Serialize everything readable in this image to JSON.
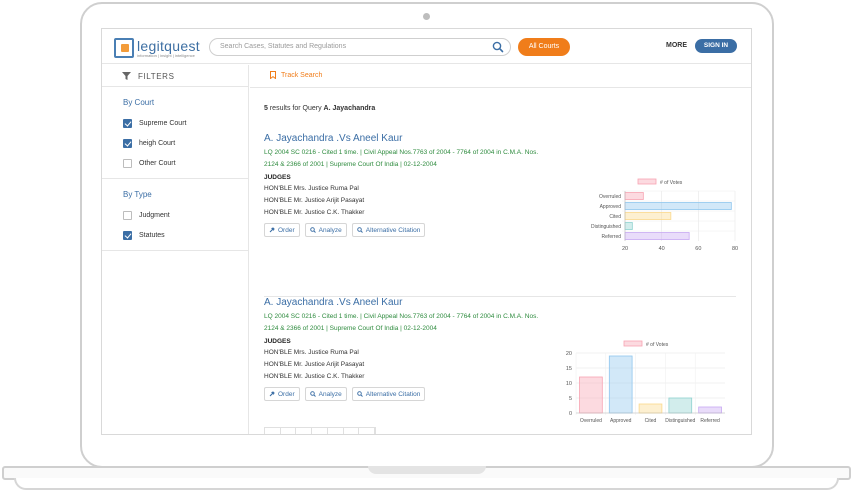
{
  "header": {
    "logo_name": "legitquest",
    "logo_tagline": "information | insight | intelligence",
    "search_placeholder": "Search Cases, Statutes and Regulations",
    "courts_button": "All Courts",
    "more_label": "MORE",
    "signin_label": "SIGN IN"
  },
  "sidebar": {
    "filters_label": "FILTERS",
    "court_group": {
      "title": "By Court",
      "options": [
        {
          "label": "Supreme Court",
          "checked": true
        },
        {
          "label": "heigh Court",
          "checked": true
        },
        {
          "label": "Other Court",
          "checked": false
        }
      ]
    },
    "type_group": {
      "title": "By Type",
      "options": [
        {
          "label": "Judgment",
          "checked": false
        },
        {
          "label": "Statutes",
          "checked": true
        }
      ]
    }
  },
  "main": {
    "track_search": "Track Search",
    "results_prefix": "5",
    "results_middle": " results for Query ",
    "results_query": "A. Jayachandra",
    "results": [
      {
        "title": "A. Jayachandra .Vs Aneel Kaur",
        "meta": "LQ 2004 SC 0216 - Cited 1 time. | Civil Appeal Nos.7763 of 2004 - 7764 of 2004 in C.M.A. Nos. 2124 & 2366 of 2001 | Supreme Court Of India | 02-12-2004",
        "judges_heading": "JUDGES",
        "judges": [
          "HON'BLE Mrs. Justice Ruma Pal",
          "HON'BLE Mr. Justice Arijit Pasayat",
          "HON'BLE Mr. Justice C.K. Thakker"
        ],
        "actions": [
          "Order",
          "Analyze",
          "Alternative Citation"
        ]
      },
      {
        "title": "A. Jayachandra .Vs Aneel Kaur",
        "meta": "LQ 2004 SC 0216 - Cited 1 time. | Civil Appeal Nos.7763 of 2004 - 7764 of 2004 in C.M.A. Nos. 2124 & 2366 of 2001 | Supreme Court Of India | 02-12-2004",
        "judges_heading": "JUDGES",
        "judges": [
          "HON'BLE Mrs. Justice Ruma Pal",
          "HON'BLE Mr. Justice Arijit Pasayat",
          "HON'BLE Mr. Justice C.K. Thakker"
        ],
        "actions": [
          "Order",
          "Analyze",
          "Alternative Citation"
        ]
      }
    ]
  },
  "chart_data": [
    {
      "type": "bar",
      "orientation": "horizontal",
      "categories": [
        "Overruled",
        "Approved",
        "Cited",
        "Distinguished",
        "Referred"
      ],
      "values": [
        30,
        78,
        45,
        24,
        55
      ],
      "series_name": "# of Votes",
      "xlim": [
        20,
        80
      ],
      "xticks": [
        20,
        40,
        60,
        80
      ],
      "colors": [
        "#f7a3b2",
        "#8fc6ee",
        "#fbd98b",
        "#8fd3d0",
        "#c7a8f3"
      ],
      "legend": "top"
    },
    {
      "type": "bar",
      "orientation": "vertical",
      "categories": [
        "Overruled",
        "Approved",
        "Cited",
        "Distinguished",
        "Referred"
      ],
      "values": [
        12,
        19,
        3,
        5,
        2
      ],
      "series_name": "# of Votes",
      "ylim": [
        0,
        20
      ],
      "yticks": [
        0,
        5,
        10,
        15,
        20
      ],
      "colors": [
        "#f7a3b2",
        "#8fc6ee",
        "#fbd98b",
        "#8fd3d0",
        "#c7a8f3"
      ],
      "legend": "top"
    }
  ]
}
